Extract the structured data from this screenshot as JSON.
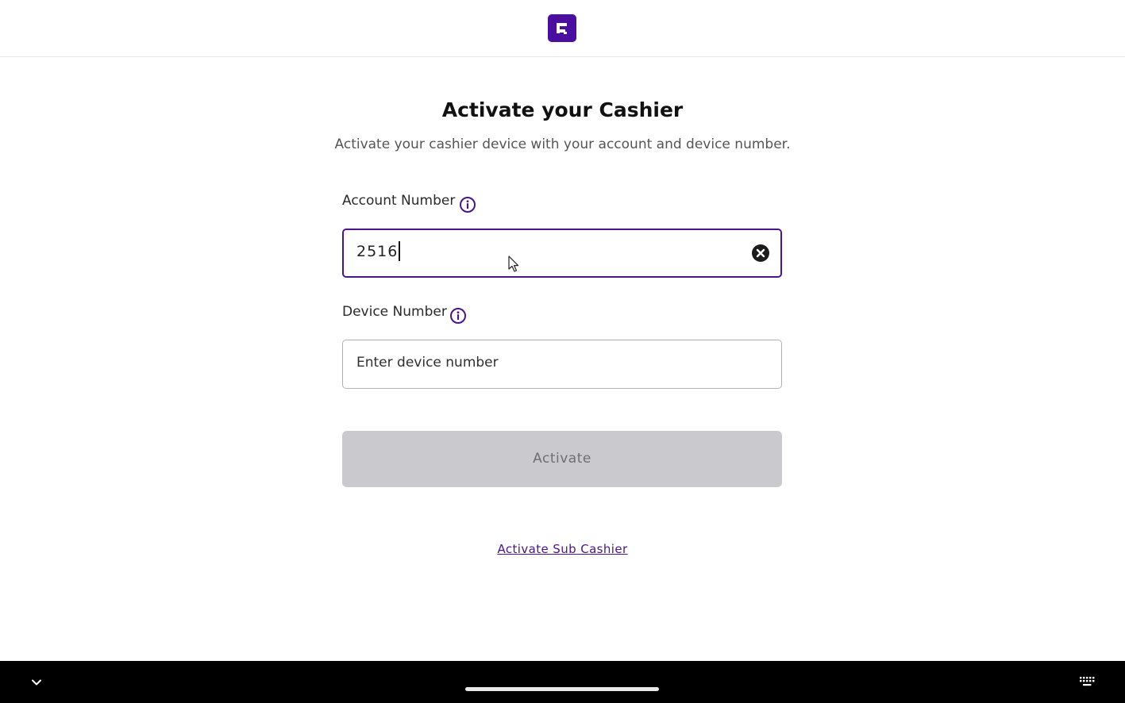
{
  "header": {
    "logo_icon": "brand-logo-icon",
    "brand_color": "#4a0f9e"
  },
  "page": {
    "title": "Activate your Cashier",
    "subtitle": "Activate your cashier device with your account and device number."
  },
  "form": {
    "account": {
      "label": "Account Number",
      "value": "2516",
      "info_icon": "info-icon",
      "clear_icon": "clear-icon"
    },
    "device": {
      "label": "Device Number",
      "placeholder": "Enter device number",
      "value": "",
      "info_icon": "info-icon"
    },
    "submit_label": "Activate"
  },
  "links": {
    "sub_cashier": "Activate Sub Cashier"
  },
  "colors": {
    "accent": "#4a148c",
    "disabled_button": "#c9c9ce",
    "nav_bar": "#000000"
  },
  "system_nav": {
    "left_icon": "chevron-down-icon",
    "right_icon": "keyboard-icon"
  }
}
